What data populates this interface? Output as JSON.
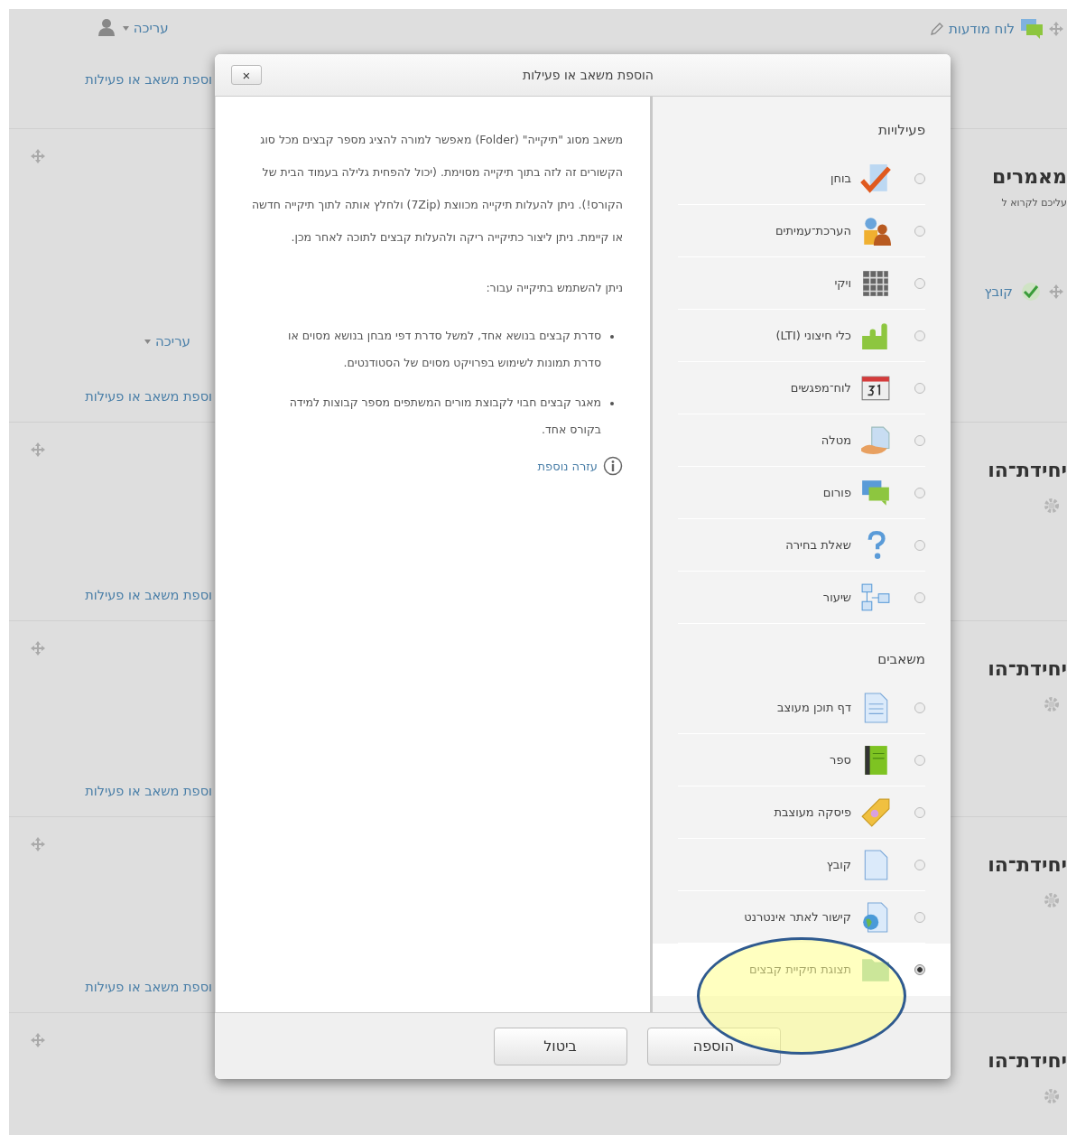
{
  "page": {
    "top": {
      "forum_link": "לוח מודעות",
      "edit_menu": "עריכה",
      "add_link": "וספת משאב או פעילות"
    },
    "sections": [
      {
        "heading": "מאמרים",
        "summary": "עליכם לקרוא ל",
        "file_link": "קובץ",
        "edit_menu": "עריכה",
        "add_link": "וספת משאב או פעילות"
      },
      {
        "heading": "יחידת־הו",
        "add_link": "וספת משאב או פעילות"
      },
      {
        "heading": "יחידת־הו",
        "add_link": "וספת משאב או פעילות"
      },
      {
        "heading": "יחידת־הו",
        "add_link": "וספת משאב או פעילות"
      },
      {
        "heading": "יחידת־הו"
      }
    ]
  },
  "modal": {
    "title": "הוספת משאב או פעילות",
    "close": "×",
    "groups": [
      {
        "heading": "פעילויות",
        "items": [
          {
            "label": "בוחן",
            "kind": "quiz",
            "selected": false
          },
          {
            "label": "הערכת־עמיתים",
            "kind": "workshop",
            "selected": false
          },
          {
            "label": "ויקי",
            "kind": "wiki",
            "selected": false
          },
          {
            "label": "כלי חיצוני (LTI)",
            "kind": "lti",
            "selected": false
          },
          {
            "label": "לוח־מפגשים",
            "kind": "calendar",
            "selected": false
          },
          {
            "label": "מטלה",
            "kind": "assignment",
            "selected": false
          },
          {
            "label": "פורום",
            "kind": "forum",
            "selected": false
          },
          {
            "label": "שאלת בחירה",
            "kind": "choice",
            "selected": false
          },
          {
            "label": "שיעור",
            "kind": "lesson",
            "selected": false
          }
        ]
      },
      {
        "heading": "משאבים",
        "items": [
          {
            "label": "דף תוכן מעוצב",
            "kind": "page",
            "selected": false
          },
          {
            "label": "ספר",
            "kind": "book",
            "selected": false
          },
          {
            "label": "פיסקה מעוצבת",
            "kind": "label",
            "selected": false
          },
          {
            "label": "קובץ",
            "kind": "file",
            "selected": false
          },
          {
            "label": "קישור לאתר אינטרנט",
            "kind": "url",
            "selected": false
          },
          {
            "label": "תצוגת תיקיית קבצים",
            "kind": "folder",
            "selected": true
          }
        ]
      }
    ],
    "help": {
      "paragraphs": [
        "משאב מסוג \"תיקייה\" (Folder) מאפשר למורה להציג מספר קבצים מכל סוג הקשורים זה לזה בתוך תיקייה מסוימת. (יכול להפחית גלילה בעמוד הבית של הקורס!). ניתן להעלות תיקייה מכווצת (7Zip) ולחלץ אותה לתוך תיקייה חדשה או קיימת. ניתן ליצור כתיקייה ריקה ולהעלות קבצים לתוכה לאחר מכן.",
        "ניתן להשתמש בתיקייה עבור:"
      ],
      "bullets": [
        "סדרת קבצים בנושא אחד, למשל סדרת דפי מבחן בנושא מסוים או סדרת תמונות לשימוש בפרויקט מסוים של הסטודנטים.",
        "מאגר קבצים חבוי לקבוצת מורים המשתפים מספר קבוצות למידה בקורס אחד."
      ],
      "link": "עזרה נוספת"
    },
    "buttons": [
      {
        "label": "הוספה"
      },
      {
        "label": "ביטול"
      }
    ]
  }
}
